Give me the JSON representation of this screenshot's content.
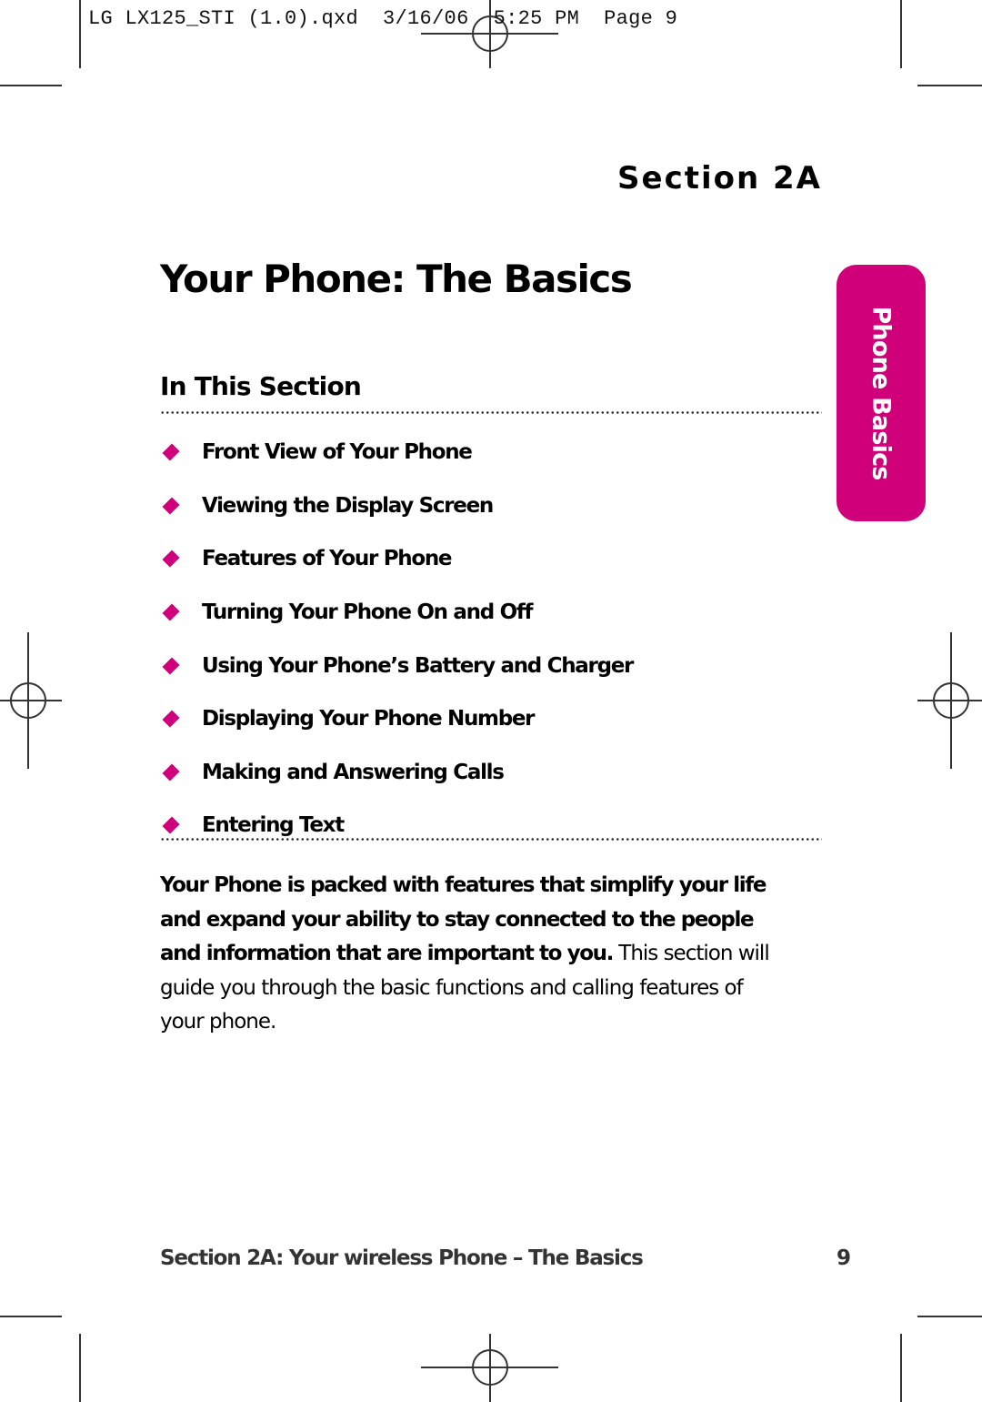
{
  "print_slug": "LG LX125_STI (1.0).qxd  3/16/06  5:25 PM  Page 9",
  "section_label": "Section 2A",
  "page_title": "Your Phone: The Basics",
  "side_tab": {
    "label": "Phone Basics",
    "color": "#d0007a"
  },
  "in_this_section": {
    "heading": "In This Section",
    "bullet_icon": "diamond-icon",
    "bullet_color": "#d0007a",
    "items": [
      "Front View of Your Phone",
      "Viewing the Display Screen",
      "Features of Your Phone",
      "Turning Your Phone On and Off",
      "Using Your Phone’s Battery and Charger",
      "Displaying Your Phone Number",
      "Making and Answering Calls",
      "Entering Text"
    ]
  },
  "intro": {
    "bold": "Your Phone is packed with features that simplify your life and expand your ability to stay connected to the people and information that are important to you.",
    "regular": " This section will guide you through the basic functions and calling features of your phone."
  },
  "footer": {
    "title": "Section 2A: Your wireless Phone – The Basics",
    "page_number": "9"
  }
}
